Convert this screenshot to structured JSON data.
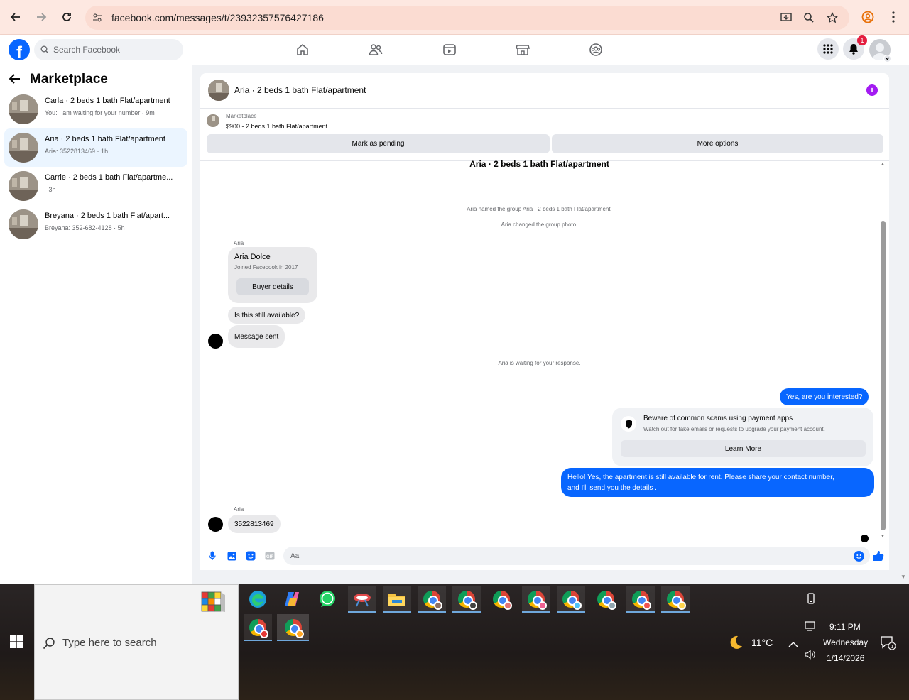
{
  "browser": {
    "url": "facebook.com/messages/t/23932357576427186"
  },
  "fb_header": {
    "search_placeholder": "Search Facebook",
    "notification_count": "1"
  },
  "sidebar": {
    "title": "Marketplace",
    "conversations": [
      {
        "title": "Carla · 2 beds 1 bath Flat/apartment",
        "subtitle": "You: I am waiting for your number · 9m",
        "active": false
      },
      {
        "title": "Aria · 2 beds 1 bath Flat/apartment",
        "subtitle": "Aria: 3522813469 · 1h",
        "active": true
      },
      {
        "title": "Carrie · 2 beds 1 bath Flat/apartme...",
        "subtitle": " · 3h",
        "active": false
      },
      {
        "title": "Breyana · 2 beds 1 bath Flat/apart...",
        "subtitle": "Breyana: 352-682-4128 · 5h",
        "active": false
      }
    ]
  },
  "chat": {
    "header_title": "Aria · 2 beds 1 bath Flat/apartment",
    "marketplace_label": "Marketplace",
    "listing": "$900 - 2 beds 1 bath Flat/apartment",
    "mark_pending_label": "Mark as pending",
    "more_options_label": "More options",
    "group_title": "Aria · 2 beds 1 bath Flat/apartment",
    "system_messages": [
      "Aria named the group Aria · 2 beds 1 bath Flat/apartment.",
      "Aria changed the group photo.",
      "Aria is waiting for your response."
    ],
    "sender_name": "Aria",
    "profile_card": {
      "name": "Aria Dolce",
      "joined": "Joined Facebook in 2017",
      "button": "Buyer details"
    },
    "incoming": [
      "Is this still available?",
      "Message sent"
    ],
    "outgoing_1": "Yes, are you interested?",
    "scam_warning": {
      "title": "Beware of common scams using payment apps",
      "subtitle": "Watch out for fake emails or requests to upgrade your payment account.",
      "button": "Learn More"
    },
    "outgoing_2_line1": "Hello! Yes, the apartment is still available for rent. Please share your contact number,",
    "outgoing_2_line2": "and I'll send you the details .",
    "last_incoming": "3522813469",
    "composer_placeholder": "Aa",
    "colors": {
      "accent": "#0866ff",
      "bubble_in": "#e9e9eb",
      "active_row": "#ebf5ff"
    }
  },
  "taskbar": {
    "search_placeholder": "Type here to search",
    "temperature": "11°C",
    "time": "9:11 PM",
    "day": "Wednesday",
    "date": "1/14/2026"
  }
}
